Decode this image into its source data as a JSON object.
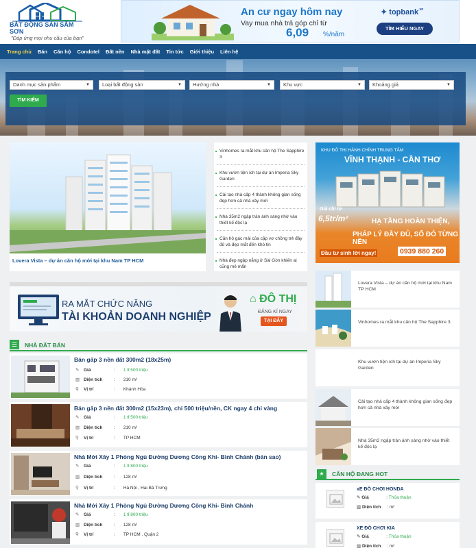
{
  "header": {
    "logo_text": "BẤT ĐỘNG SẢN SẦM SƠN",
    "slogan": "\"Đáp ứng mọi nhu cầu của bạn\"",
    "banner": {
      "title": "An cư ngay hôm nay",
      "subtitle": "Vay mua nhà trả góp chỉ từ",
      "rate": "6,09",
      "rate_unit": "%/năm",
      "brand": "topbank",
      "brand_suffix": ".vn",
      "cta": "TÌM HIỂU NGAY"
    }
  },
  "nav": {
    "items": [
      "Trang chủ",
      "Bán",
      "Căn hộ",
      "Condotel",
      "Đất nền",
      "Nhà mặt đất",
      "Tin tức",
      "Giới thiệu",
      "Liên hệ"
    ],
    "active_index": 0
  },
  "search": {
    "selects": [
      "Danh mục sản phẩm",
      "Loại bất động sản",
      "Hướng nhà",
      "Khu vực",
      "Khoảng giá"
    ],
    "button": "TÌM KIẾM"
  },
  "feature": {
    "caption": "Lovera Vista – dự án căn hộ mới tại khu Nam TP HCM"
  },
  "news_list": [
    "Vinhomes ra mắt khu căn hộ The Sapphire 3",
    "Khu vườn tiện ích tại dự án Imperia Sky Garden",
    "Cải tạo nhà cấp 4 thành không gian sống đẹp hơn cả nhà xây mới",
    "Nhà 35m2 ngập tràn ánh sáng nhờ vào thiết kế độc lạ",
    "Căn hộ gác mái của cặp vợ chồng trẻ đầy đủ và đẹp mắt đến khó tin",
    "Nhà đẹp ngập nắng ở Sài Gòn khiến ai cũng mê mẩn"
  ],
  "ad_right": {
    "line1": "KHU ĐÔ THỊ HÀNH CHÍNH TRUNG TÂM",
    "line2": "VĨNH THẠNH - CẦN THƠ",
    "line3": "Giá chỉ từ",
    "line4": "6,5tr/m²",
    "line5": "HẠ TẦNG HOÀN THIỆN,",
    "line6": "PHÁP LÝ ĐẦY ĐỦ, SỔ ĐỎ TỪNG NỀN",
    "line7": "Đầu tư sinh lời ngay!",
    "phone": "0939 880 260"
  },
  "biz_banner": {
    "line1": "RA MẮT CHỨC NĂNG",
    "line2": "TÀI KHOẢN DOANH NGHIỆP",
    "brand": "ĐÔ THỊ",
    "register": "ĐĂNG KÍ NGAY",
    "cta": "TẠI ĐÂY"
  },
  "section_sale": {
    "title": "NHÀ ĐẤT BÁN",
    "label_price": "Giá",
    "label_area": "Diện tích",
    "label_location": "Vị trí",
    "listings": [
      {
        "title": "Bán gấp 3 nền đất 300m2 (18x25m)",
        "price": "1 tỉ 500 triệu",
        "area": "210 m²",
        "location": "Khánh Hòa"
      },
      {
        "title": "Bán gấp 3 nền đất 300m2 (15x23m), chỉ 500 triệu/nền, CK ngay 4 chỉ vàng",
        "price": "1 tỉ 500 triệu",
        "area": "210 m²",
        "location": "TP HCM"
      },
      {
        "title": "Nhà Mới Xây 1 Phòng Ngủ Đường Dương Công Khi- Bình Chánh (bản sao)",
        "price": "1 tỉ 800 triệu",
        "area": "128 m²",
        "location": "Hà Nội , Hai Bà Trưng"
      },
      {
        "title": "Nhà Mới Xây 1 Phòng Ngủ Đường Dương Công Khi- Bình Chánh",
        "price": "1 tỉ 800 triệu",
        "area": "128 m²",
        "location": "TP HCM , Quận 2"
      }
    ]
  },
  "right_news": [
    "Lovera Vista – dự án căn hộ mới tại khu Nam TP HCM",
    "Vinhomes ra mắt khu căn hộ The Sapphire 3",
    "Khu vườn tiện ích tại dự án Imperia Sky Garden",
    "Cải tạo nhà cấp 4 thành không gian sống đẹp hơn cả nhà xây mới",
    "Nhà 35m2 ngập tràn ánh sáng nhờ vào thiết kế độc lạ"
  ],
  "hot": {
    "title": "CĂN HỘ ĐANG HOT",
    "label_price": "Giá",
    "label_area": "Diện tích",
    "items": [
      {
        "name": "xE ĐỒ CHƠI HONDA",
        "price": "Thỏa thuận",
        "area": "m²"
      },
      {
        "name": "XE ĐỒ CHƠI KIA",
        "price": "Thỏa thuận",
        "area": "m²"
      }
    ]
  },
  "colors": {
    "nav": "#175188",
    "accent_green": "#2fab4e",
    "link": "#1c5a98"
  }
}
